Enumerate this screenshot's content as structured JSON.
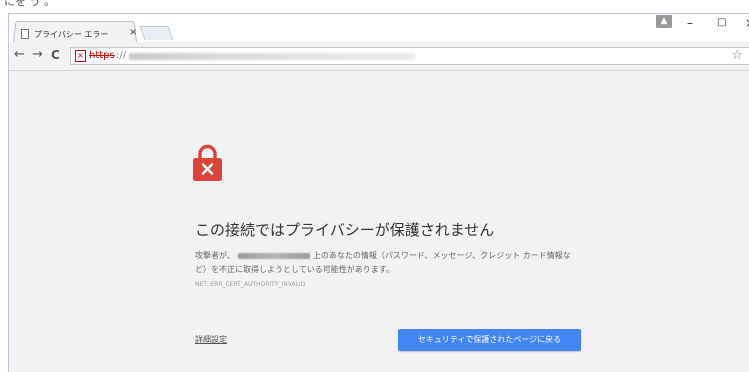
{
  "top_crop_text": "にを う 。",
  "tab": {
    "title": "プライバシー エラー",
    "close": "×"
  },
  "window_controls": {
    "user": "▲",
    "minimize": "–",
    "maximize": "□",
    "close": "×"
  },
  "toolbar": {
    "back": "←",
    "forward": "→",
    "reload": "C",
    "url_scheme": "https",
    "url_sep": "://",
    "star": "☆"
  },
  "error": {
    "title": "この接続ではプライバシーが保護されません",
    "desc_pre": "攻撃者が、",
    "desc_post": "上のあなたの情報（パスワード、メッセージ、クレジット カード情報など）を不正に取得しようとしている可能性があります。",
    "code": "NET::ERR_CERT_AUTHORITY_INVALID",
    "details_label": "詳細設定",
    "back_label": "セキュリティで保護されたページに戻る"
  },
  "colors": {
    "accent": "#4285f4",
    "error_red": "#db4437",
    "background": "#f2f2f2"
  }
}
